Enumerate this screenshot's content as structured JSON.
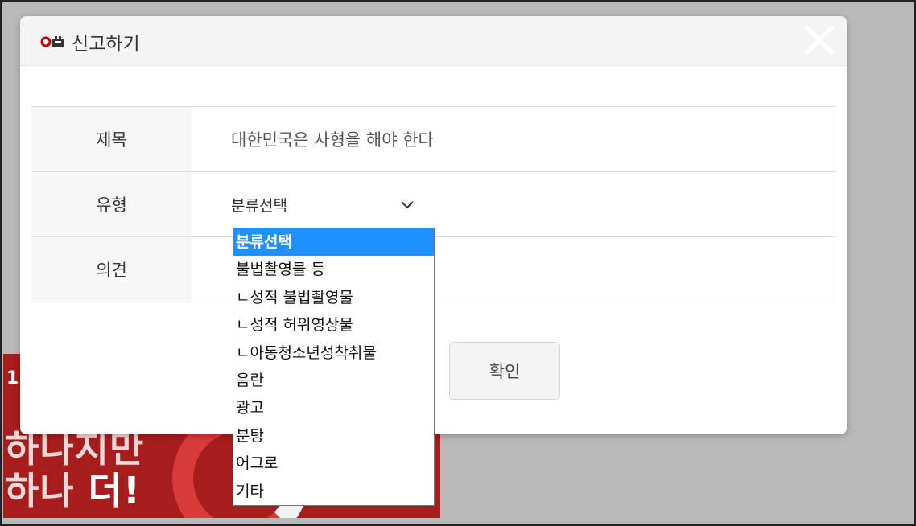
{
  "background_banner": {
    "number": "1",
    "line1": "하나지만",
    "line2_part1": "하나 ",
    "line2_part2": "더!"
  },
  "modal": {
    "title": "신고하기",
    "rows": [
      {
        "label": "제목",
        "value": "대한민국은 사형을 해야 한다"
      },
      {
        "label": "유형",
        "select_value": "분류선택"
      },
      {
        "label": "의견",
        "value": ""
      }
    ],
    "confirm_label": "확인"
  },
  "dropdown": {
    "options": [
      "분류선택",
      "불법촬영물 등",
      "ㄴ성적 불법촬영물",
      "ㄴ성적 허위영상물",
      "ㄴ아동청소년성착취물",
      "음란",
      "광고",
      "분탕",
      "어그로",
      "기타"
    ],
    "selected_index": 0
  },
  "colors": {
    "accent": "#1e90ff",
    "brand_red": "#c00000",
    "banner": "#a71d1d"
  },
  "icons": {
    "title": "report-siren-icon",
    "close": "close-icon",
    "select": "chevron-down-icon"
  }
}
